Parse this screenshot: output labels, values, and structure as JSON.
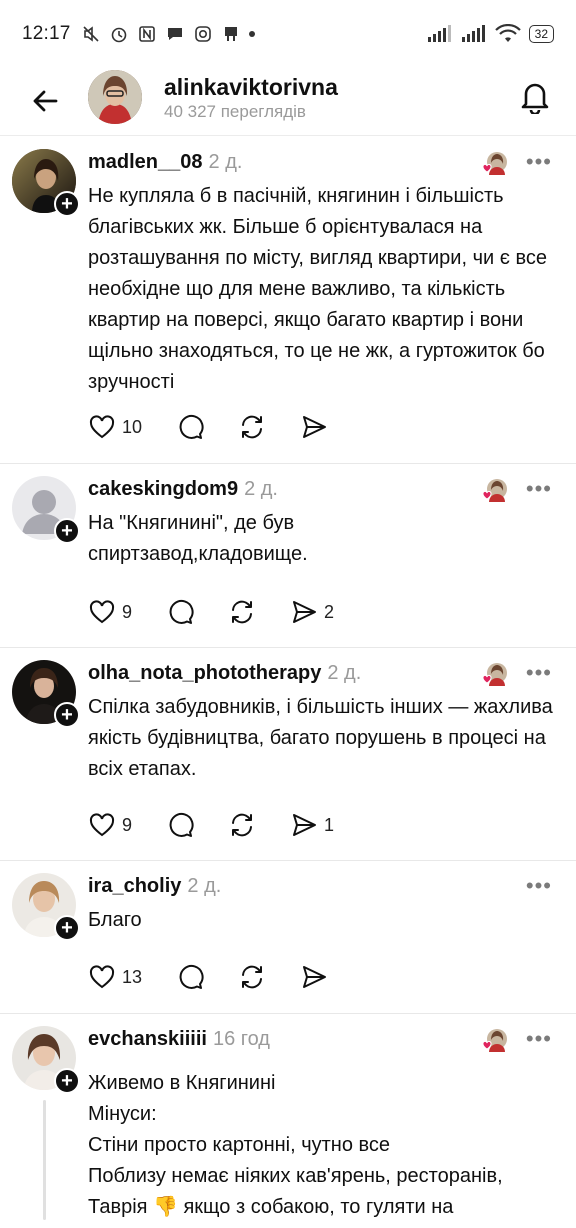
{
  "status_bar": {
    "time": "12:17",
    "battery": "32"
  },
  "header": {
    "username": "alinkaviktorivna",
    "views": "40 327 переглядів"
  },
  "posts": [
    {
      "username": "madlen__08",
      "time": "2 д.",
      "text": "Не купляла б в пасічній, княгинин і більшість благівських жк. Більше б орієнтувалася на розташування по місту, вигляд квартири, чи є все необхідне що для мене важливо, та кількість квартир на поверсі, якщо багато квартир і вони щільно знаходяться, то це не жк, а гуртожиток бо зручності",
      "likes": "10",
      "reposts": ""
    },
    {
      "username": "cakeskingdom9",
      "time": "2 д.",
      "text": "На \"Княгинині\", де був спиртзавод,кладовище.",
      "likes": "9",
      "reposts": "2"
    },
    {
      "username": "olha_nota_phototherapy",
      "time": "2 д.",
      "text": "Спілка забудовників, і більшість інших — жахлива якість будівництва, багато порушень в процесі на всіх етапах.",
      "likes": "9",
      "reposts": "1"
    },
    {
      "username": "ira_choliy",
      "time": "2 д.",
      "text": "Благо",
      "likes": "13",
      "reposts": ""
    },
    {
      "username": "evchanskiiiii",
      "time": "16 год",
      "lines": [
        "Живемо в Княгинині",
        "Мінуси:",
        "Стіни просто картонні, чутно все",
        "Поблизу немає ніяких кав'ярень, ресторанів,",
        "Таврія 👎 якщо з собакою, то гуляти на"
      ]
    }
  ]
}
